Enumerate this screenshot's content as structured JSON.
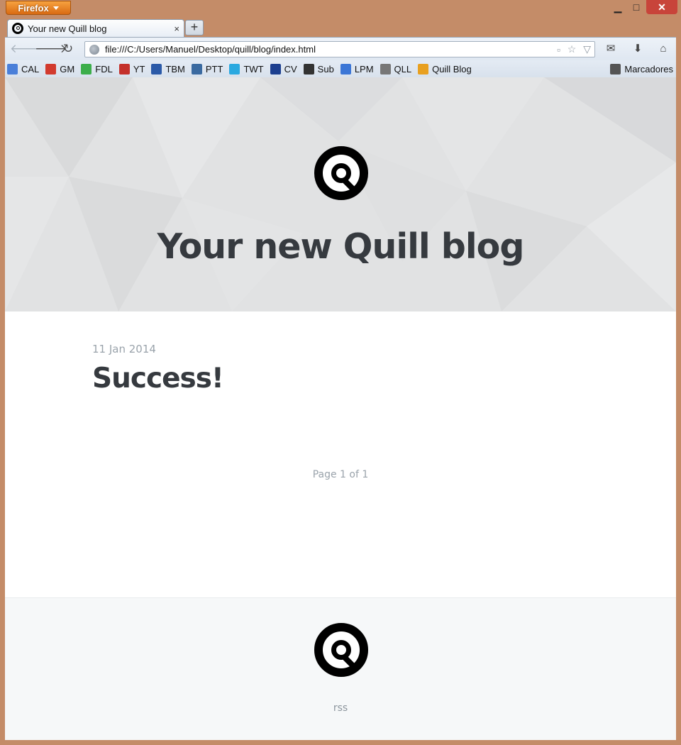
{
  "window": {
    "app_button": "Firefox",
    "controls": {
      "minimize": "▁",
      "maximize": "□",
      "close": "✕"
    }
  },
  "tab": {
    "title": "Your new Quill blog",
    "close": "×",
    "new_tab": "+"
  },
  "nav": {
    "url": "file:///C:/Users/Manuel/Desktop/quill/blog/index.html"
  },
  "bookmarks": {
    "items": [
      {
        "label": "CAL",
        "icon": "calendar-icon",
        "color": "#4a7fd9"
      },
      {
        "label": "GM",
        "icon": "gmail-icon",
        "color": "#d23b2f"
      },
      {
        "label": "FDL",
        "icon": "feedly-icon",
        "color": "#3cae4a"
      },
      {
        "label": "YT",
        "icon": "youtube-icon",
        "color": "#c4302b"
      },
      {
        "label": "TBM",
        "icon": "tbm-icon",
        "color": "#2b5aa8"
      },
      {
        "label": "PTT",
        "icon": "ptt-icon",
        "color": "#3a6aa0"
      },
      {
        "label": "TWT",
        "icon": "twitter-icon",
        "color": "#2aa9e0"
      },
      {
        "label": "CV",
        "icon": "cv-icon",
        "color": "#1c3f8f"
      },
      {
        "label": "Sub",
        "icon": "headphones-icon",
        "color": "#333333"
      },
      {
        "label": "LPM",
        "icon": "google-icon",
        "color": "#3b76d6"
      },
      {
        "label": "QLL",
        "icon": "dashed-box-icon",
        "color": "#777777"
      },
      {
        "label": "Quill Blog",
        "icon": "rss-icon",
        "color": "#e8a020"
      }
    ],
    "right": "Marcadores"
  },
  "page": {
    "hero_title": "Your new Quill blog",
    "post": {
      "date": "11 Jan 2014",
      "title": "Success!"
    },
    "pager": "Page 1 of 1",
    "footer_link": "rss"
  }
}
